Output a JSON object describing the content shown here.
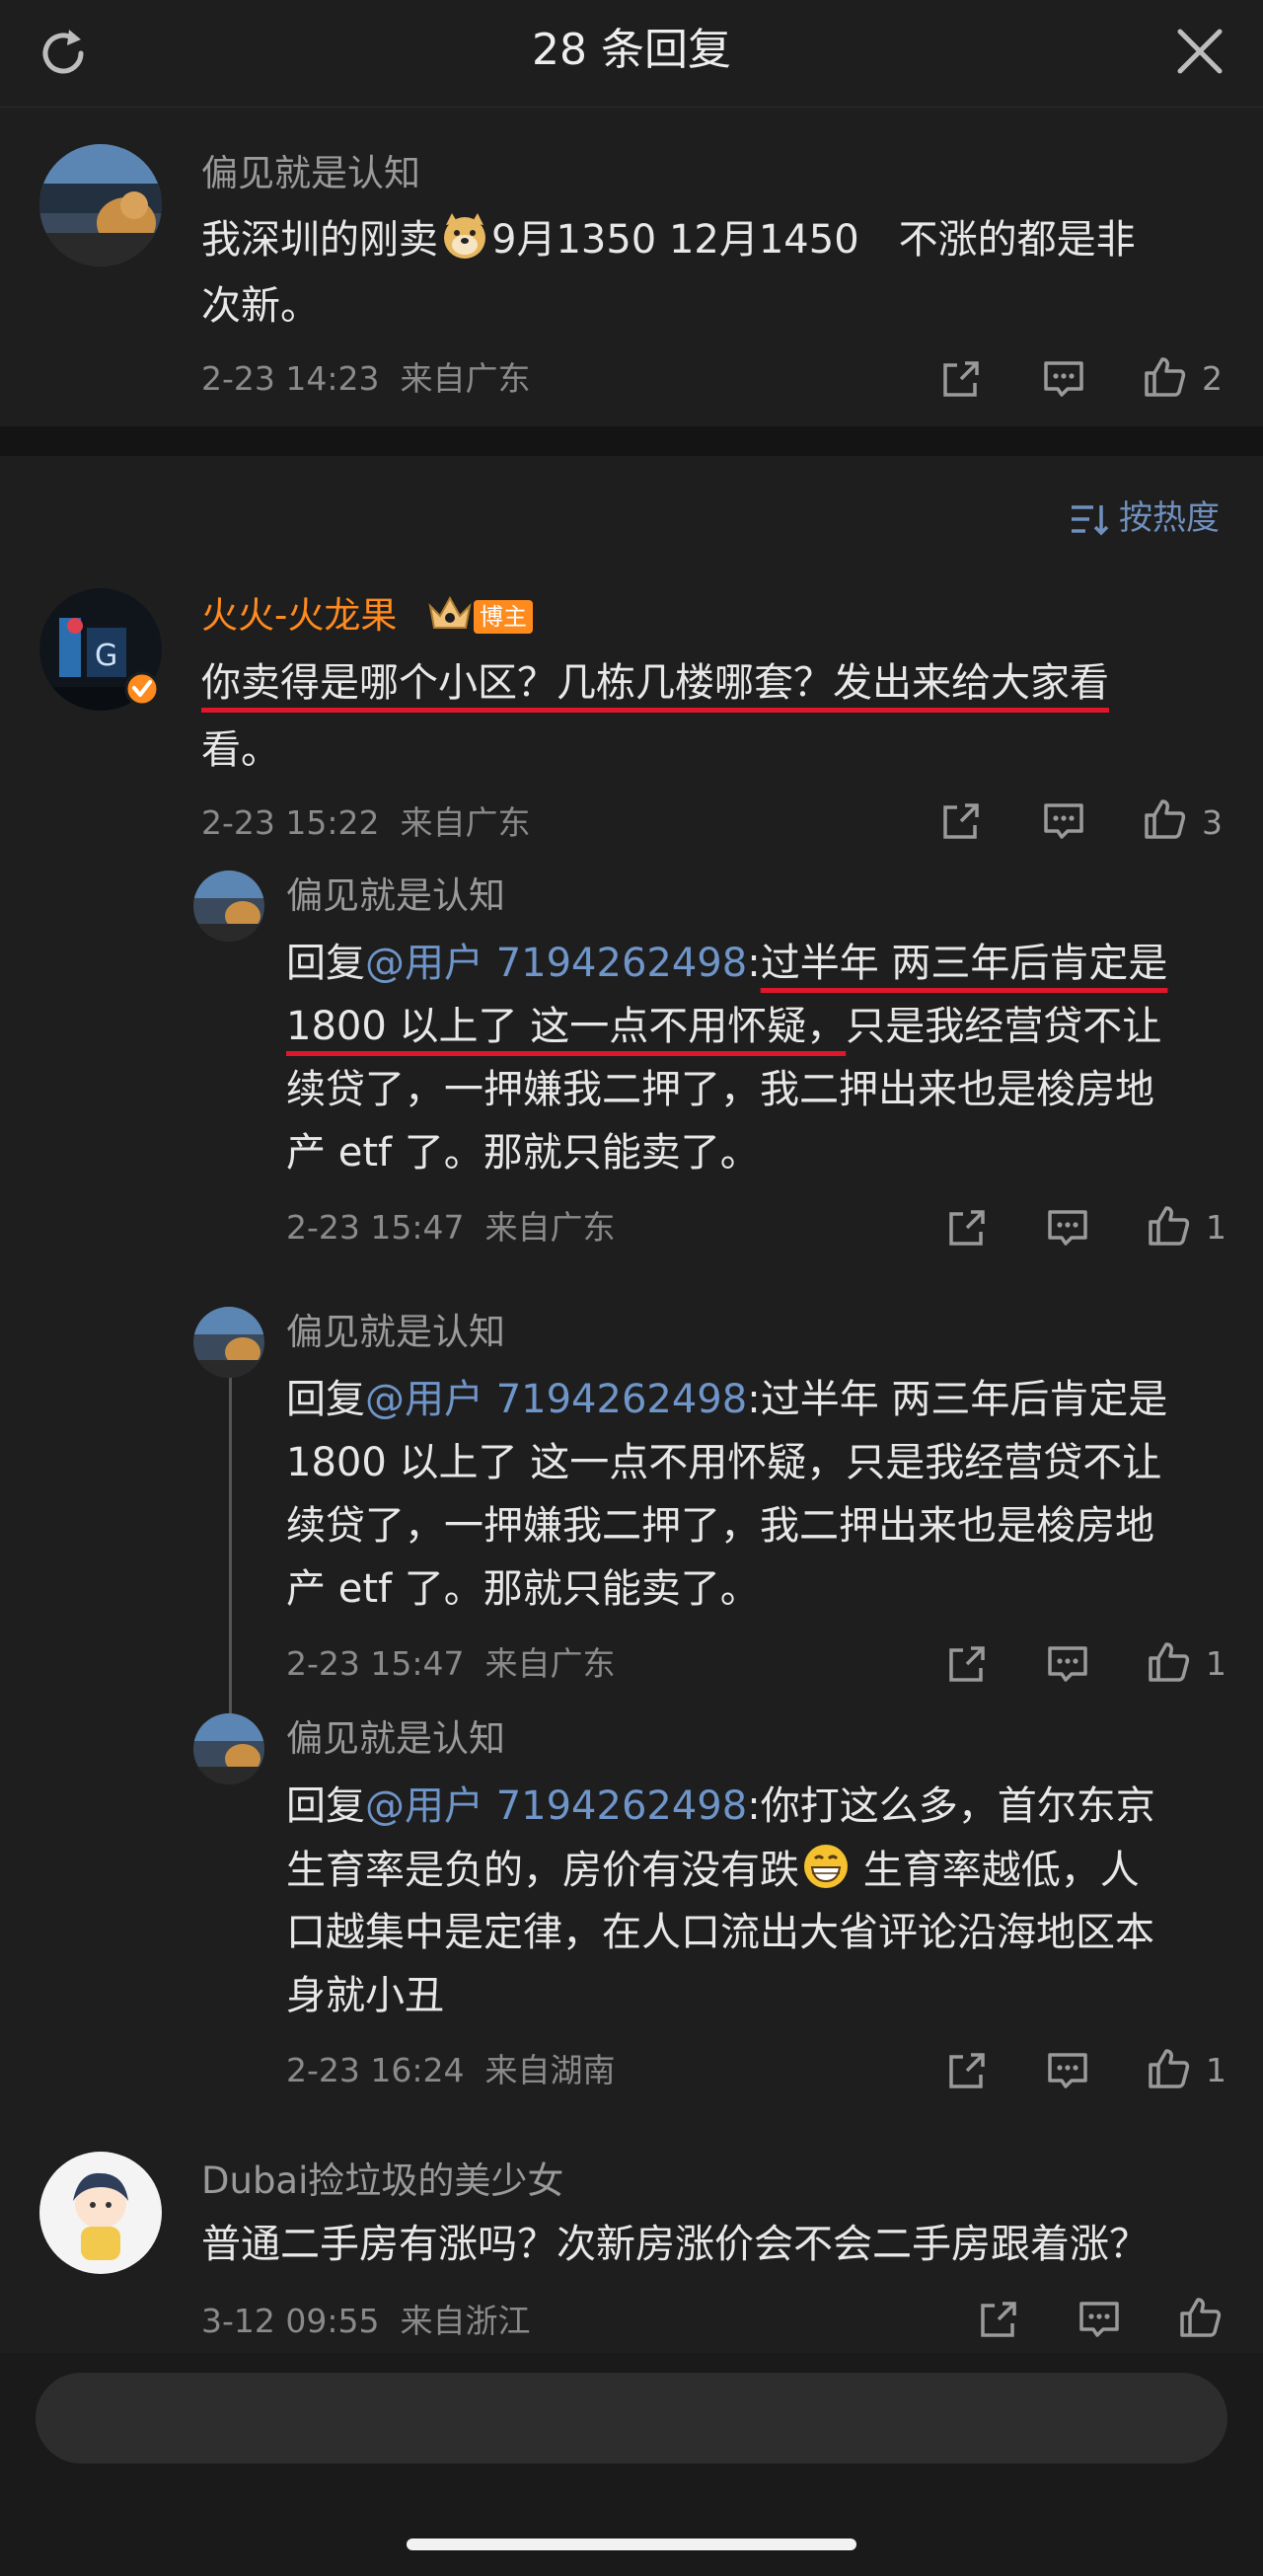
{
  "header": {
    "title": "28 条回复"
  },
  "sort": {
    "label": "按热度"
  },
  "main_post": {
    "author": "偏见就是认知",
    "text_before_emoji": "我深圳的刚卖",
    "text_after_emoji_line1": "9月1350 12月1450　不涨的都是非",
    "text_line2": "次新。",
    "time": "2-23 14:23",
    "location": "来自广东",
    "likes": "2"
  },
  "comment1": {
    "author": "火火-火龙果",
    "badge": "博主",
    "text_line1": "你卖得是哪个小区？几栋几楼哪套？发出来给大家看",
    "text_line2": "看。",
    "time": "2-23 15:22",
    "location": "来自广东",
    "likes": "3",
    "replies": [
      {
        "author": "偏见就是认知",
        "prefix": "回复",
        "mention": "@用户 7194262498",
        "colon": ":",
        "line1_ul": "过半年 两三年后肯定是",
        "line2_ul": "1800 以上了 这一点不用怀疑，",
        "line2_rest": "只是我经营贷不让",
        "line3": "续贷了，一押嫌我二押了，我二押出来也是梭房地",
        "line4": "产 etf 了。那就只能卖了。",
        "time": "2-23 15:47",
        "location": "来自广东",
        "likes": "1"
      },
      {
        "author": "偏见就是认知",
        "prefix": "回复",
        "mention": "@用户 7194262498",
        "line1_rest": ":过半年 两三年后肯定是",
        "line2": "1800 以上了 这一点不用怀疑，只是我经营贷不让",
        "line3": "续贷了，一押嫌我二押了，我二押出来也是梭房地",
        "line4": "产 etf 了。那就只能卖了。",
        "time": "2-23 15:47",
        "location": "来自广东",
        "likes": "1"
      },
      {
        "author": "偏见就是认知",
        "prefix": "回复",
        "mention": "@用户 7194262498",
        "line1_rest": ":你打这么多，首尔东京",
        "line2_before_emoji": "生育率是负的，房价有没有跌",
        "line2_after_emoji": " 生育率越低，人",
        "line3": "口越集中是定律，在人口流出大省评论沿海地区本",
        "line4": "身就小丑",
        "time": "2-23 16:24",
        "location": "来自湖南",
        "likes": "1"
      }
    ]
  },
  "comment2": {
    "author": "Dubai捡垃圾的美少女",
    "text": "普通二手房有涨吗？次新房涨价会不会二手房跟着涨？",
    "time": "3-12 09:55",
    "location": "来自浙江"
  },
  "colors": {
    "background": "#1e1e1e",
    "mention": "#6f95c9",
    "blogger_name": "#ff8a1e",
    "underline": "#e0162b"
  },
  "icons": [
    "refresh-icon",
    "close-icon",
    "share-icon",
    "comment-icon",
    "like-icon",
    "sort-icon",
    "doge-emoji",
    "grin-emoji",
    "verified-icon",
    "crown-icon"
  ]
}
